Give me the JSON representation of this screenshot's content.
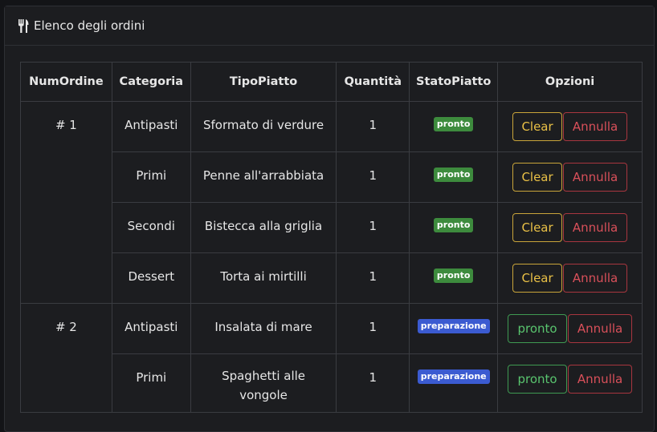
{
  "header": {
    "icon": "utensils-icon",
    "title": "Elenco degli ordini"
  },
  "table": {
    "columns": [
      "NumOrdine",
      "Categoria",
      "TipoPiatto",
      "Quantità",
      "StatoPiatto",
      "Opzioni"
    ],
    "orders": [
      {
        "num": "# 1",
        "rows": [
          {
            "categoria": "Antipasti",
            "tipo": "Sformato di verdure",
            "quantita": "1",
            "stato": "pronto",
            "action": "Clear",
            "annulla": "Annulla"
          },
          {
            "categoria": "Primi",
            "tipo": "Penne all'arrabbiata",
            "quantita": "1",
            "stato": "pronto",
            "action": "Clear",
            "annulla": "Annulla"
          },
          {
            "categoria": "Secondi",
            "tipo": "Bistecca alla griglia",
            "quantita": "1",
            "stato": "pronto",
            "action": "Clear",
            "annulla": "Annulla"
          },
          {
            "categoria": "Dessert",
            "tipo": "Torta ai mirtilli",
            "quantita": "1",
            "stato": "pronto",
            "action": "Clear",
            "annulla": "Annulla"
          }
        ]
      },
      {
        "num": "# 2",
        "rows": [
          {
            "categoria": "Antipasti",
            "tipo": "Insalata di mare",
            "quantita": "1",
            "stato": "preparazione",
            "action": "pronto",
            "annulla": "Annulla"
          },
          {
            "categoria": "Primi",
            "tipo": "Spaghetti alle vongole",
            "quantita": "1",
            "stato": "preparazione",
            "action": "pronto",
            "annulla": "Annulla"
          }
        ]
      }
    ]
  },
  "colors": {
    "background": "#131417",
    "card": "#1c1d20",
    "badge_pronto": "#3d8b3d",
    "badge_preparazione": "#3b5bd1",
    "clear_button": "#e9c046",
    "annulla_button": "#d9505a",
    "pronto_button": "#59c46e"
  }
}
